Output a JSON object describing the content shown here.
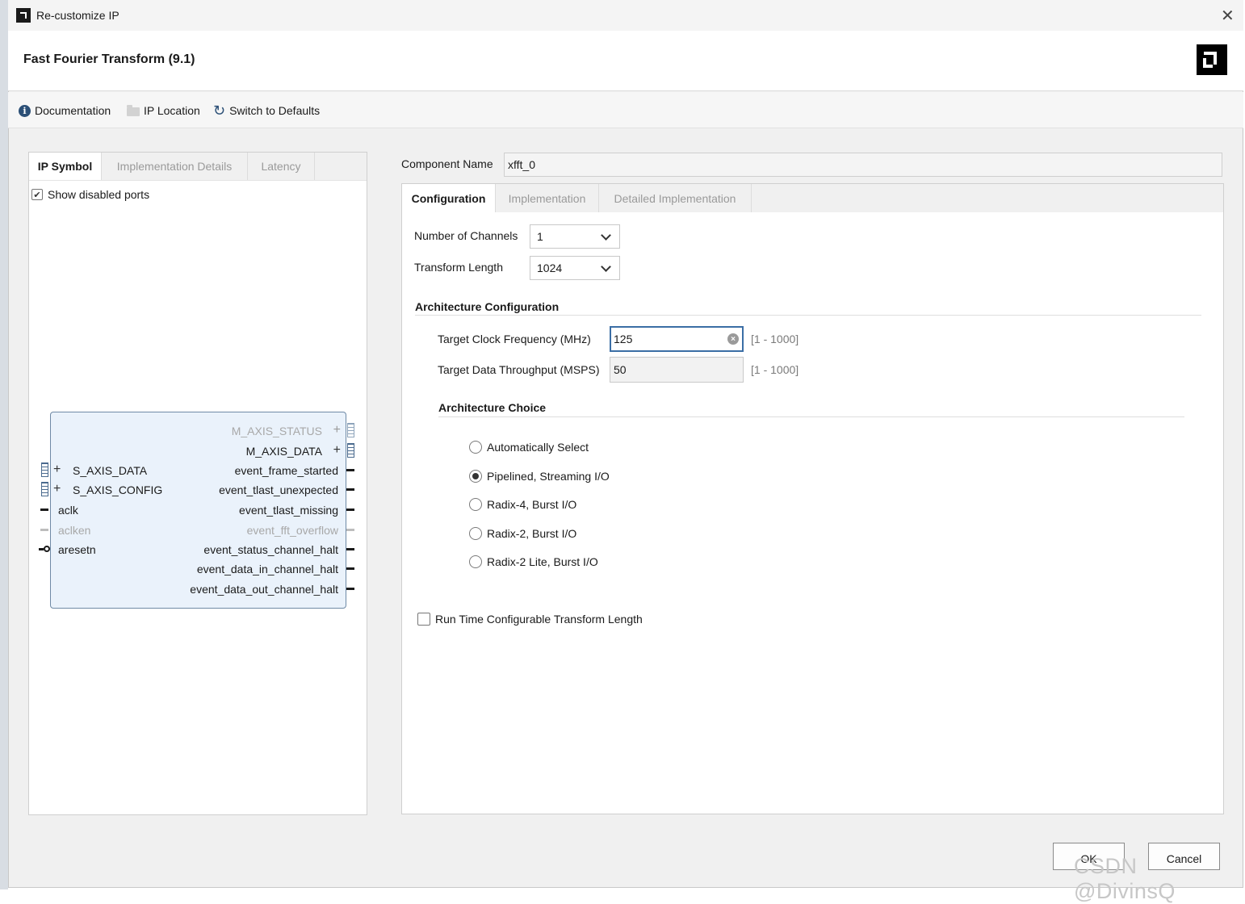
{
  "window": {
    "title": "Re-customize IP",
    "close_glyph": "✕"
  },
  "header": {
    "ip_title": "Fast Fourier Transform (9.1)"
  },
  "toolbar": {
    "documentation": "Documentation",
    "ip_location": "IP Location",
    "switch_defaults": "Switch to Defaults"
  },
  "left": {
    "tabs": [
      "IP Symbol",
      "Implementation Details",
      "Latency"
    ],
    "show_disabled_ports": "Show disabled ports",
    "show_disabled_checked": true,
    "ports_left": [
      {
        "name": "S_AXIS_DATA",
        "kind": "bus",
        "enabled": true
      },
      {
        "name": "S_AXIS_CONFIG",
        "kind": "bus",
        "enabled": true
      },
      {
        "name": "aclk",
        "kind": "wire",
        "enabled": true
      },
      {
        "name": "aclken",
        "kind": "wire",
        "enabled": false
      },
      {
        "name": "aresetn",
        "kind": "wire-inverted",
        "enabled": true
      }
    ],
    "ports_right": [
      {
        "name": "M_AXIS_STATUS",
        "kind": "bus",
        "enabled": false
      },
      {
        "name": "M_AXIS_DATA",
        "kind": "bus",
        "enabled": true
      },
      {
        "name": "event_frame_started",
        "kind": "wire",
        "enabled": true
      },
      {
        "name": "event_tlast_unexpected",
        "kind": "wire",
        "enabled": true
      },
      {
        "name": "event_tlast_missing",
        "kind": "wire",
        "enabled": true
      },
      {
        "name": "event_fft_overflow",
        "kind": "wire",
        "enabled": false
      },
      {
        "name": "event_status_channel_halt",
        "kind": "wire",
        "enabled": true
      },
      {
        "name": "event_data_in_channel_halt",
        "kind": "wire",
        "enabled": true
      },
      {
        "name": "event_data_out_channel_halt",
        "kind": "wire",
        "enabled": true
      }
    ]
  },
  "right": {
    "component_name_label": "Component Name",
    "component_name_value": "xfft_0",
    "tabs": [
      "Configuration",
      "Implementation",
      "Detailed Implementation"
    ],
    "num_channels_label": "Number of Channels",
    "num_channels_value": "1",
    "transform_length_label": "Transform Length",
    "transform_length_value": "1024",
    "arch_config_heading": "Architecture Configuration",
    "target_clock_label": "Target Clock Frequency (MHz)",
    "target_clock_value": "125",
    "target_clock_range": "[1 - 1000]",
    "target_throughput_label": "Target Data Throughput (MSPS)",
    "target_throughput_value": "50",
    "target_throughput_range": "[1 - 1000]",
    "arch_choice_heading": "Architecture Choice",
    "arch_options": [
      {
        "label": "Automatically Select",
        "selected": false
      },
      {
        "label": "Pipelined, Streaming I/O",
        "selected": true
      },
      {
        "label": "Radix-4, Burst I/O",
        "selected": false
      },
      {
        "label": "Radix-2, Burst I/O",
        "selected": false
      },
      {
        "label": "Radix-2 Lite, Burst I/O",
        "selected": false
      }
    ],
    "runtime_config_label": "Run Time Configurable Transform Length",
    "runtime_config_checked": false
  },
  "footer": {
    "ok": "OK",
    "cancel": "Cancel"
  },
  "watermark": "CSDN @DivinsQ",
  "colors": {
    "accent": "#2b4f76",
    "symbol_fill": "#eaf2fb",
    "focus_border": "#3b6ea5"
  },
  "icons": {
    "info": "info-icon",
    "folder": "folder-icon",
    "refresh": "refresh-icon",
    "close": "close-icon",
    "clear": "clear-input-icon"
  }
}
